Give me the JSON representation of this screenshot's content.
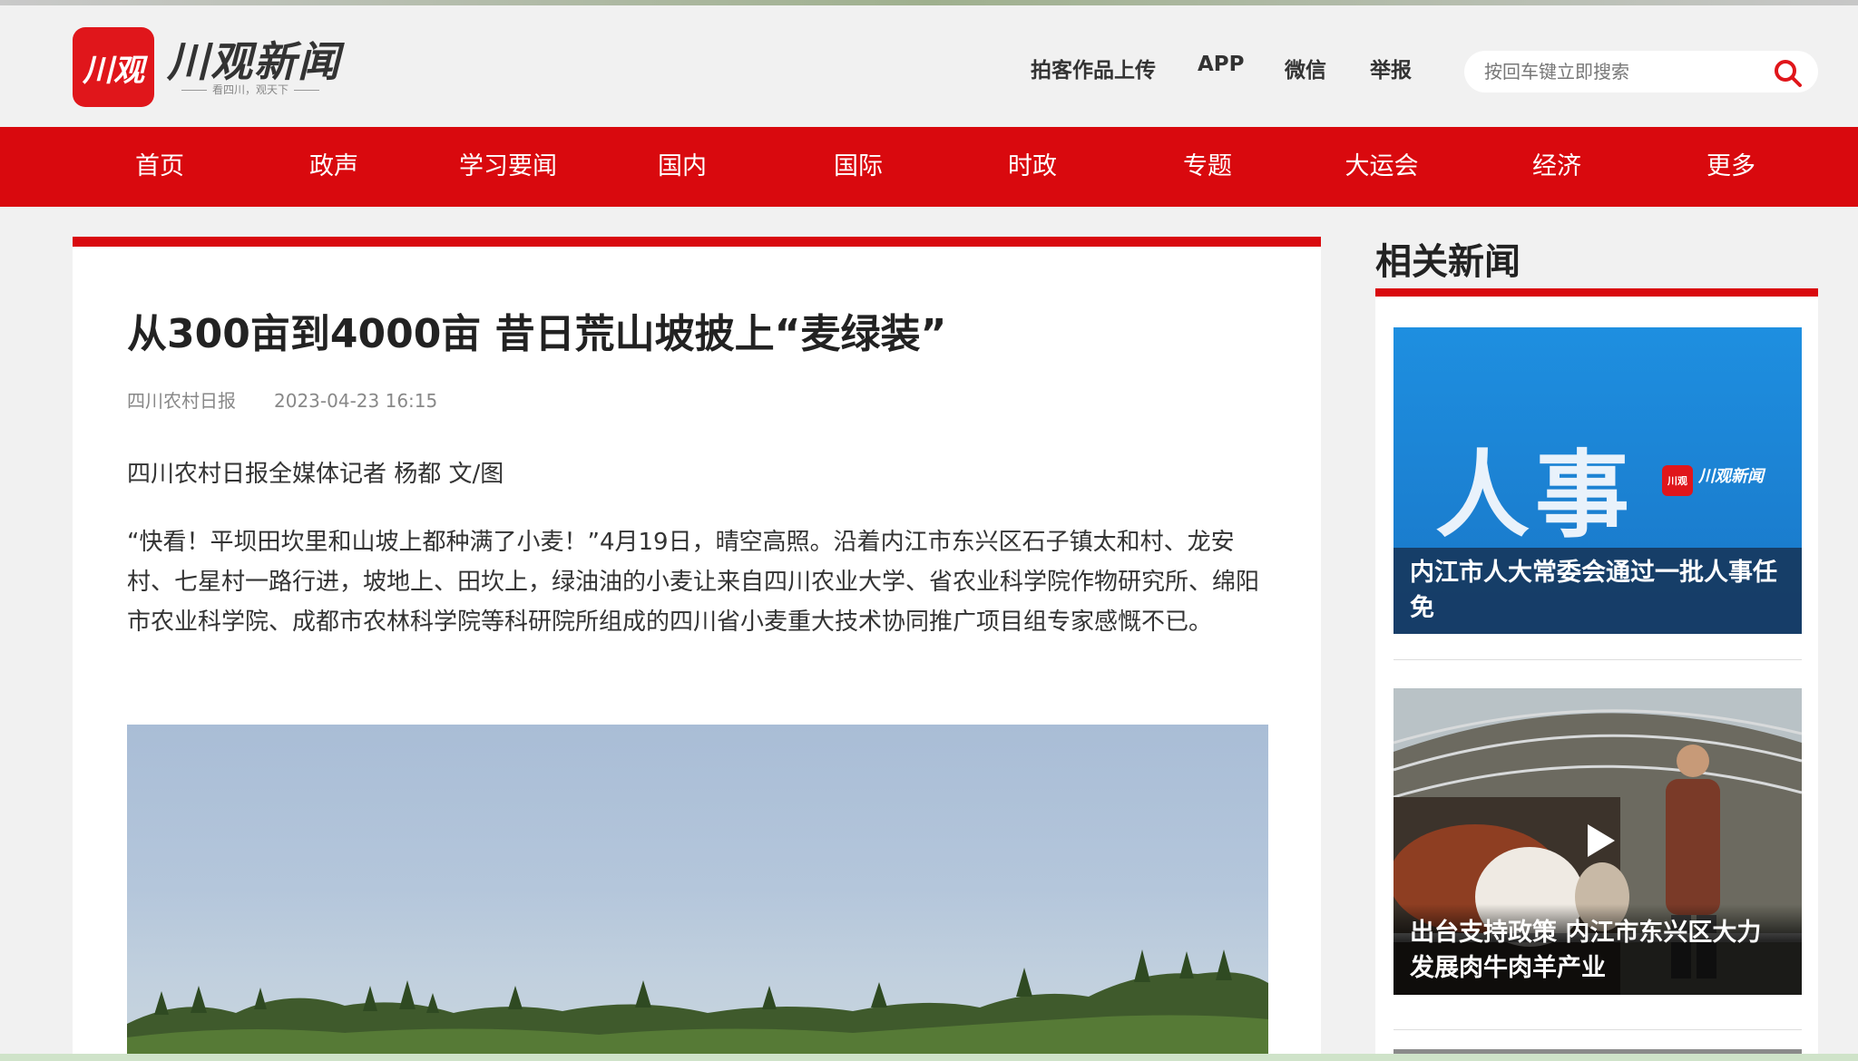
{
  "brand": {
    "logo_text": "川观",
    "name": "川观新闻",
    "slogan": "看四川，观天下",
    "primary_color": "#d9090e"
  },
  "toplinks": [
    "拍客作品上传",
    "APP",
    "微信",
    "举报"
  ],
  "search": {
    "placeholder": "按回车键立即搜索",
    "value": ""
  },
  "nav": [
    "首页",
    "政声",
    "学习要闻",
    "国内",
    "国际",
    "时政",
    "专题",
    "大运会",
    "经济",
    "更多"
  ],
  "article": {
    "title": "从300亩到4000亩 昔日荒山坡披上“麦绿装”",
    "source": "四川农村日报",
    "datetime": "2023-04-23 16:15",
    "byline": "四川农村日报全媒体记者 杨都 文/图",
    "paragraph": "“快看！平坝田坎里和山坡上都种满了小麦！”4月19日，晴空高照。沿着内江市东兴区石子镇太和村、龙安村、七星村一路行进，坡地上、田坎上，绿油油的小麦让来自四川农业大学、省农业科学院作物研究所、绵阳市农业科学院、成都市农林科学院等科研院所组成的四川省小麦重大技术协同推广项目组专家感慨不已。"
  },
  "sidebar": {
    "title": "相关新闻",
    "items": [
      {
        "image_text": "人事",
        "image_logo": "川观",
        "image_logo_name": "川观新闻",
        "caption": "内江市人大常委会通过一批人事任免"
      },
      {
        "caption": "出台支持政策 内江市东兴区大力发展肉牛肉羊产业",
        "video": true
      }
    ]
  }
}
